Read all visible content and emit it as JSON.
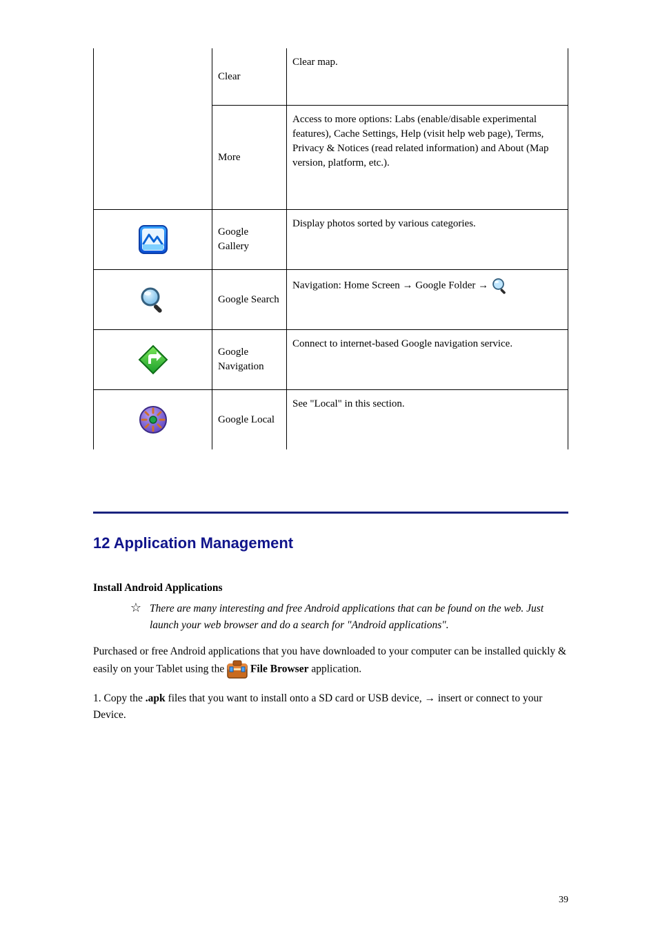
{
  "table": {
    "rows": [
      {
        "c1_icon": null,
        "c2": "Clear",
        "c3": "Clear map."
      },
      {
        "c1_icon": null,
        "c2": "More",
        "c3": "Access to more options: Labs (enable/disable experimental features), Cache Settings, Help (visit help web page), Terms, Privacy & Notices (read related information) and About (Map version, platform, etc.)."
      },
      {
        "c1_icon": "gallery",
        "c2": "Google Gallery",
        "c3": "Display photos sorted by various categories."
      },
      {
        "c1_icon": "magnifier",
        "c2": "Google Search",
        "c3": "Navigation: Home Screen → Google Folder → [magnifier]"
      },
      {
        "c1_icon": "nav",
        "c2": "Google Navigation",
        "c3": "Connect to internet-based Google navigation service."
      },
      {
        "c1_icon": "local",
        "c2": "Google Local",
        "c3": "See \"Local\" in this section."
      }
    ]
  },
  "section": {
    "title": "12 Application Management",
    "install_heading": "Install Android Applications",
    "tip_text": "There are many interesting and free Android applications that can be found on the web. Just launch your web browser and do a search for \"Android applications\".",
    "para2_a": "Purchased or free Android applications that you have downloaded to your computer can be installed quickly & easily on your Tablet using the ",
    "para2_b": "File Browser",
    "para2_c": " application.",
    "step1_a": "1. Copy the ",
    "step1_b": ".apk",
    "step1_c": " files that you want to install onto a SD card or USB device, ",
    "step1_d": "→",
    "step1_e": " insert or connect to your Device."
  },
  "page_number": "39"
}
